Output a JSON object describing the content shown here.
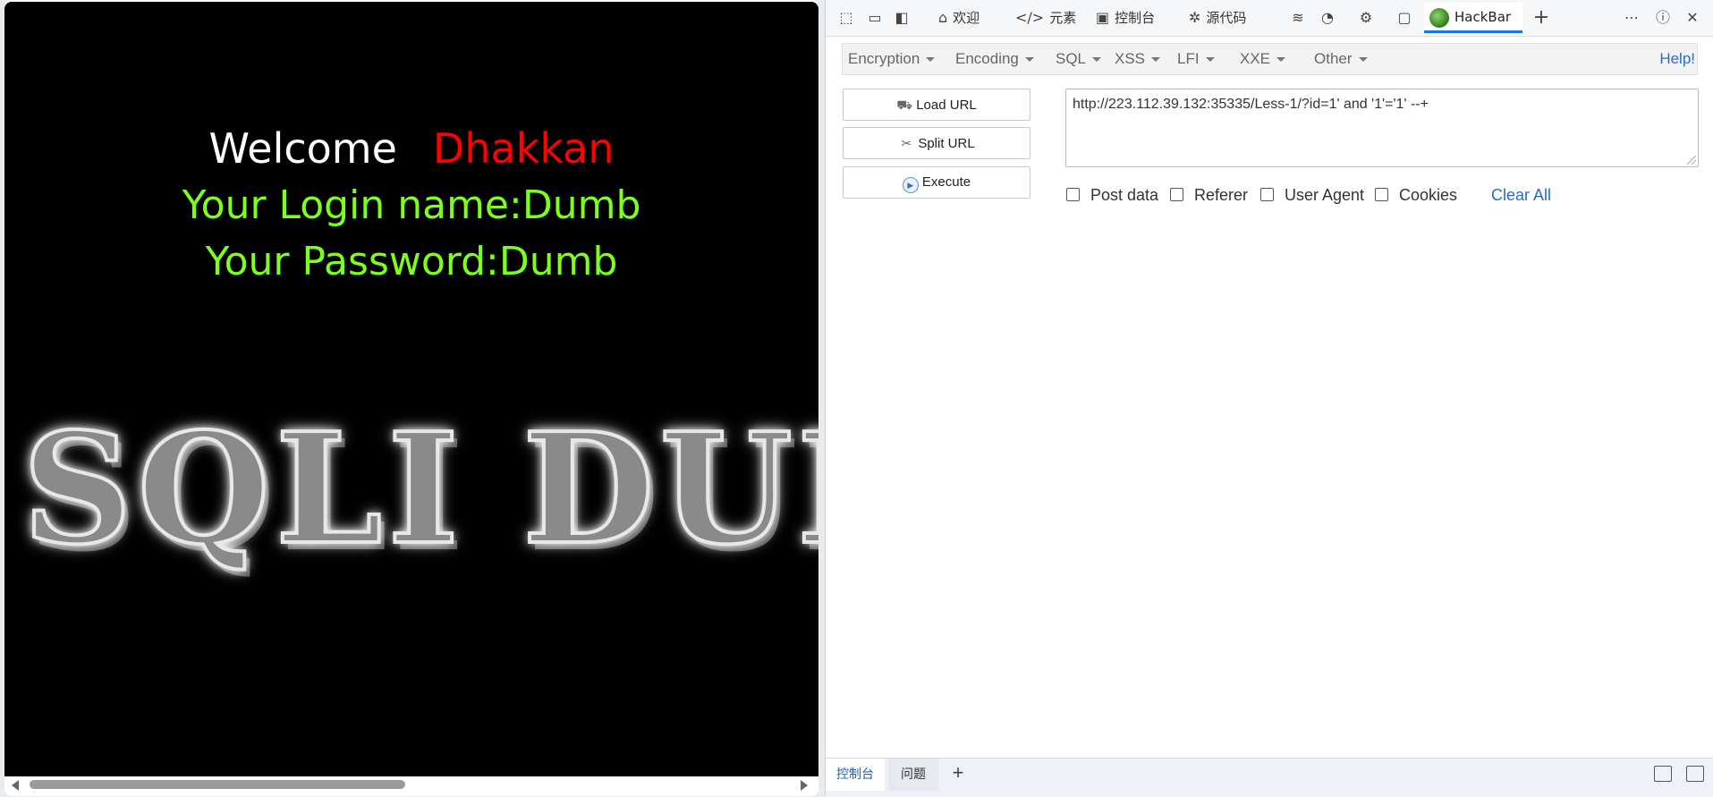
{
  "page": {
    "welcome": "Welcome",
    "name": "Dhakkan",
    "login_line": "Your Login name:Dumb",
    "password_line": "Your Password:Dumb",
    "logo_text": "SQLI DUMB"
  },
  "devtools": {
    "toolbar": {
      "icons": [
        "inspect-icon",
        "device-emulation-icon",
        "dock-sidebar-icon"
      ],
      "tabs": [
        {
          "label": "欢迎",
          "icon": "home-icon"
        },
        {
          "label": "元素",
          "icon": "code-icon"
        },
        {
          "label": "控制台",
          "icon": "console-icon"
        },
        {
          "label": "源代码",
          "icon": "bug-icon"
        }
      ],
      "extra_icons": [
        "network-wifi-icon",
        "performance-icon",
        "memory-chip-icon",
        "application-icon"
      ],
      "active_tab": "HackBar",
      "right_icons": [
        "more-icon",
        "help-icon",
        "close-icon"
      ]
    },
    "hackbar": {
      "menu": [
        "Encryption",
        "Encoding",
        "SQL",
        "XSS",
        "LFI",
        "XXE",
        "Other"
      ],
      "help": "Help!",
      "buttons": {
        "load": "Load URL",
        "split": "Split URL",
        "execute": "Execute"
      },
      "url_value": "http://223.112.39.132:35335/Less-1/?id=1' and '1'='1' --+",
      "options": [
        "Post data",
        "Referer",
        "User Agent",
        "Cookies"
      ],
      "clear_all": "Clear All"
    },
    "drawer": {
      "tabs": [
        "控制台",
        "问题"
      ]
    }
  }
}
